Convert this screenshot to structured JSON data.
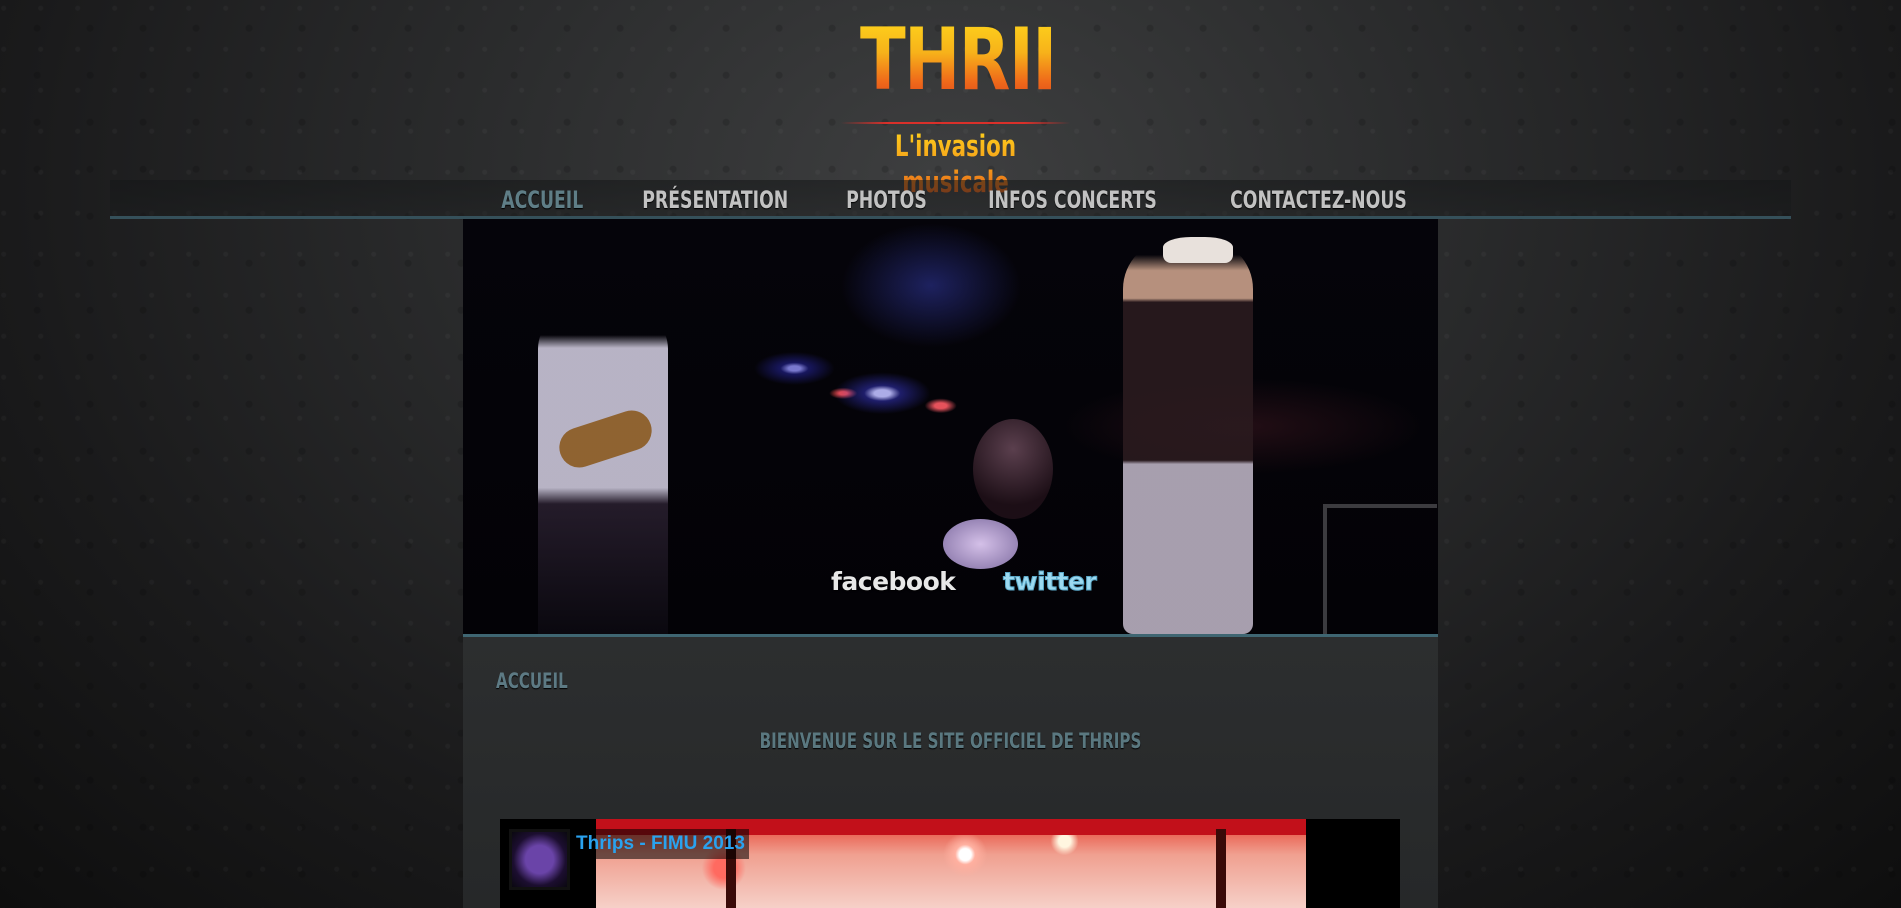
{
  "logo": {
    "title": "THRIPS",
    "subtitle": "L'invasion musicale"
  },
  "nav": {
    "items": [
      {
        "label": "ACCUEIL",
        "active": true
      },
      {
        "label": "PRÉSENTATION"
      },
      {
        "label": "PHOTOS"
      },
      {
        "label": "INFOS CONCERTS"
      },
      {
        "label": "CONTACTEZ-NOUS"
      }
    ]
  },
  "hero": {
    "facebook_label": "facebook",
    "twitter_label": "twitter"
  },
  "content": {
    "title": "ACCUEIL",
    "welcome": "BIENVENUE SUR LE SITE OFFICIEL DE THRIPS"
  },
  "video": {
    "title": "Thrips - FIMU 2013"
  },
  "colors": {
    "accent": "#5f7e87",
    "nav_text": "#c2c2c2",
    "video_title": "#2aa2ee"
  }
}
